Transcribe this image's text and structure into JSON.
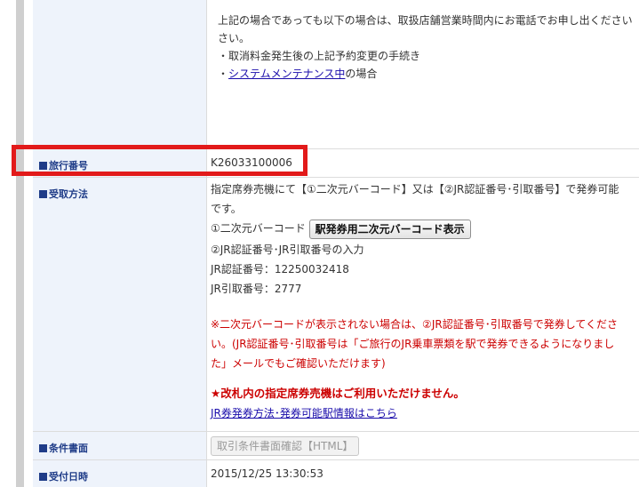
{
  "notice": {
    "lines": [
      "上記の場合であっても以下の場合は、取扱店舗営業時間内にお電話でお申し出ください",
      "さい。",
      "・取消料金発生後の上記予約変更の手続き"
    ],
    "maintenance_prefix": "・",
    "maintenance_link": "システムメンテナンス中",
    "maintenance_suffix": "の場合"
  },
  "travel_number": {
    "label": "旅行番号",
    "value": "K26033100006"
  },
  "receipt_method": {
    "label": "受取方法",
    "line1": "指定席券売機にて【①二次元バーコード】又は【②JR認証番号･引取番号】で発券可能",
    "line2": "です。",
    "barcode_prefix": "①二次元バーコード",
    "barcode_button": "駅発券用二次元バーコード表示",
    "jr_input": "②JR認証番号･JR引取番号の入力",
    "jr_auth": "JR認証番号：12250032418",
    "jr_pickup": "JR引取番号：2777",
    "warning1": "※二次元バーコードが表示されない場合は、②JR認証番号･引取番号で発券してくださ",
    "warning2": "い。(JR認証番号･引取番号は「ご旅行のJR乗車票類を駅で発券できるようになりまし",
    "warning3": "た」メールでもご確認いただけます)",
    "caution": "★改札内の指定席券売機はご利用いただけません。",
    "info_link": "JR券発券方法･発券可能駅情報はこちら"
  },
  "conditions": {
    "label": "条件書面",
    "button": "取引条件書面確認【HTML】"
  },
  "received_date": {
    "label": "受付日時",
    "value": "2015/12/25 13:30:53"
  },
  "colors": {
    "accent": "#1f3c88",
    "label_bg": "#eef3fb",
    "warning": "#cc0000",
    "highlight": "#e21a1a"
  }
}
